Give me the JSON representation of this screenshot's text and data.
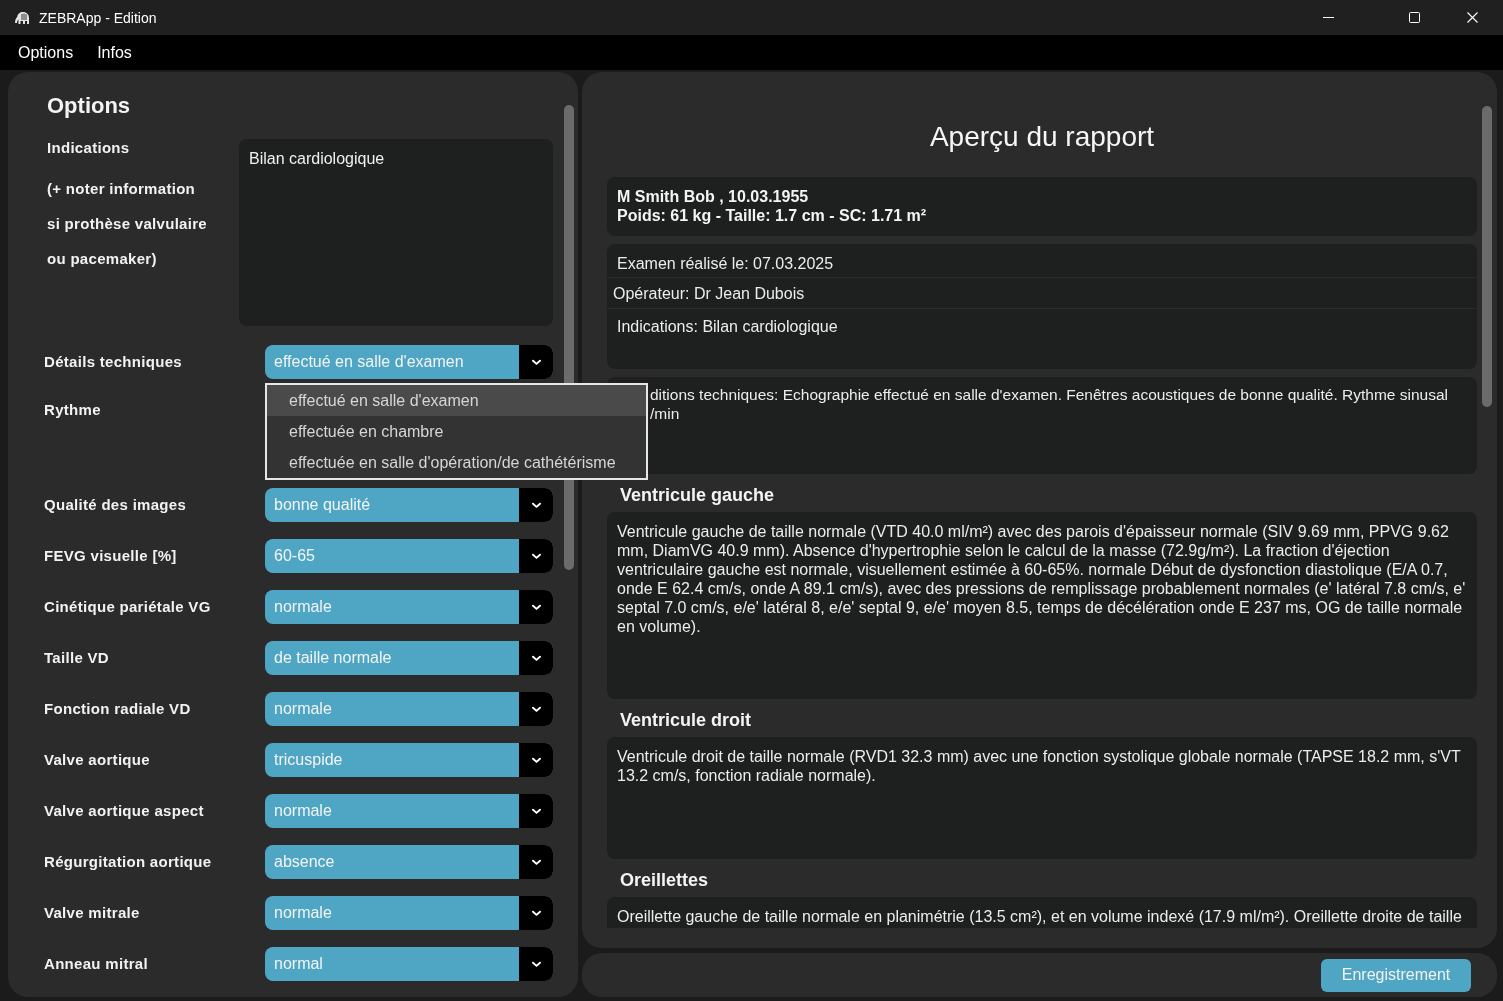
{
  "window": {
    "title": "ZEBRApp - Edition"
  },
  "menu": [
    "Options",
    "Infos"
  ],
  "options_panel": {
    "title": "Options",
    "indications": {
      "label": "Indications",
      "note": "(+ noter information\nsi prothèse valvulaire\nou pacemaker)",
      "value": "Bilan cardiologique"
    },
    "fields": [
      {
        "label": "Détails techniques",
        "value": "effectué en salle d'examen",
        "options": [
          {
            "label": "effectué en salle d'examen",
            "selected": true
          },
          {
            "label": "effectuée en chambre",
            "selected": false
          },
          {
            "label": "effectuée en salle d'opération/de cathétérisme",
            "selected": false
          }
        ]
      },
      {
        "label": "Rythme"
      },
      {
        "label": "Qualité des images",
        "value": "bonne qualité"
      },
      {
        "label": "FEVG visuelle [%]",
        "value": "60-65"
      },
      {
        "label": "Cinétique pariétale VG",
        "value": "normale"
      },
      {
        "label": "Taille VD",
        "value": "de taille normale"
      },
      {
        "label": "Fonction radiale VD",
        "value": "normale"
      },
      {
        "label": "Valve aortique",
        "value": "tricuspide"
      },
      {
        "label": "Valve aortique aspect",
        "value": "normale"
      },
      {
        "label": "Régurgitation aortique",
        "value": "absence"
      },
      {
        "label": "Valve mitrale",
        "value": "normale"
      },
      {
        "label": "Anneau mitral",
        "value": "normal"
      }
    ]
  },
  "report": {
    "title": "Aperçu du rapport",
    "patient_lines": [
      "M Smith Bob , 10.03.1955",
      "Poids: 61 kg - Taille: 1.7 cm - SC: 1.71 m²"
    ],
    "exam_lines": [
      "Examen réalisé le: 07.03.2025",
      "Opérateur: Dr Jean Dubois",
      "Indications: Bilan cardiologique"
    ],
    "conditions": "ditions techniques: Echographie effectué en salle d'examen. Fenêtres acoustiques de bonne qualité. Rythme sinusal\n/min",
    "sections": [
      {
        "heading": "Ventricule gauche",
        "text": "Ventricule gauche de taille normale (VTD 40.0 ml/m²) avec des parois d'épaisseur normale (SIV 9.69 mm, PPVG 9.62 mm, DiamVG 40.9 mm). Absence d'hypertrophie selon le calcul de la masse (72.9g/m²). La fraction d'éjection ventriculaire gauche est normale, visuellement estimée à 60-65%. normale Début de dysfonction diastolique (E/A 0.7, onde E 62.4 cm/s, onde A 89.1 cm/s), avec des pressions de remplissage probablement normales (e' latéral 7.8 cm/s, e' septal 7.0 cm/s, e/e' latéral 8, e/e' septal 9, e/e' moyen 8.5, temps de décélération onde E 237 ms, OG de taille normale en volume)."
      },
      {
        "heading": "Ventricule droit",
        "text": "Ventricule droit de taille normale (RVD1 32.3 mm) avec une fonction systolique globale normale (TAPSE 18.2 mm, s'VT 13.2 cm/s, fonction radiale normale)."
      },
      {
        "heading": "Oreillettes",
        "text": "Oreillette gauche de taille normale en planimétrie (13.5 cm²), et en volume indexé (17.9 ml/m²). Oreillette droite de taille"
      }
    ]
  },
  "save_button": "Enregistrement"
}
